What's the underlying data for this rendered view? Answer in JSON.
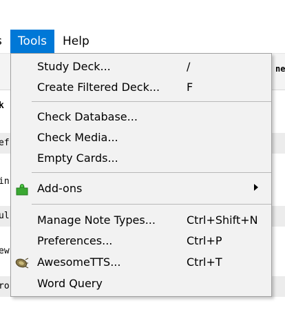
{
  "menubar": {
    "prev_label": "s",
    "tools_label": "Tools",
    "help_label": "Help"
  },
  "background": {
    "header_col": "ne",
    "deck_label": "k",
    "rows": [
      "ef",
      "in",
      "ul",
      "ew",
      "ro"
    ]
  },
  "menu": {
    "study_deck": {
      "label": "Study Deck...",
      "shortcut": "/"
    },
    "create_filtered": {
      "label": "Create Filtered Deck...",
      "shortcut": "F"
    },
    "check_database": {
      "label": "Check Database..."
    },
    "check_media": {
      "label": "Check Media..."
    },
    "empty_cards": {
      "label": "Empty Cards..."
    },
    "addons": {
      "label": "Add-ons",
      "icon": "puzzle-icon"
    },
    "manage_note_types": {
      "label": "Manage Note Types...",
      "shortcut": "Ctrl+Shift+N"
    },
    "preferences": {
      "label": "Preferences...",
      "shortcut": "Ctrl+P"
    },
    "awesometts": {
      "label": "AwesomeTTS...",
      "shortcut": "Ctrl+T",
      "icon": "speaker-icon"
    },
    "word_query": {
      "label": "Word Query"
    }
  },
  "colors": {
    "menu_highlight": "#0078d7",
    "menu_background": "#f2f2f2",
    "addons_icon": "#3aa832"
  }
}
